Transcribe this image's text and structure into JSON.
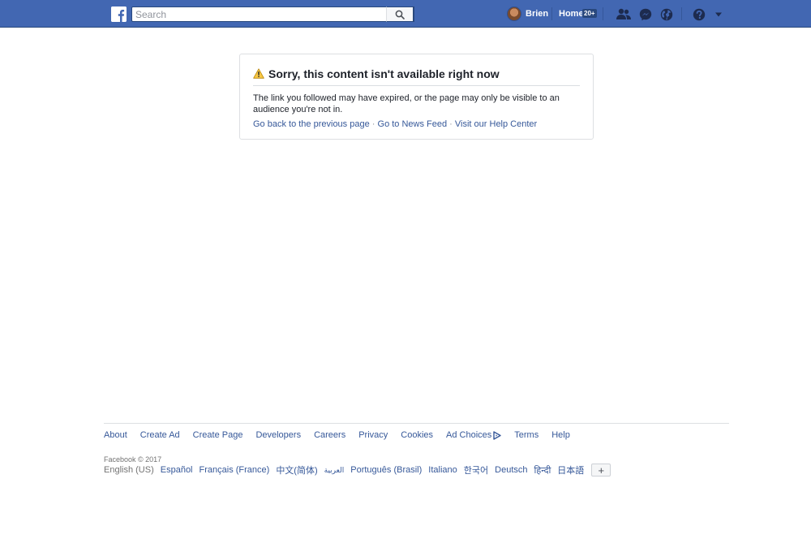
{
  "header": {
    "search_placeholder": "Search",
    "user_name": "Brien",
    "home_label": "Home",
    "home_badge": "20+"
  },
  "error": {
    "title": "Sorry, this content isn't available right now",
    "message": "The link you followed may have expired, or the page may only be visible to an audience you're not in.",
    "links": [
      "Go back to the previous page",
      "Go to News Feed",
      "Visit our Help Center"
    ],
    "separator": "·"
  },
  "footer": {
    "links": [
      "About",
      "Create Ad",
      "Create Page",
      "Developers",
      "Careers",
      "Privacy",
      "Cookies",
      "Ad Choices",
      "Terms",
      "Help"
    ],
    "copyright": "Facebook © 2017",
    "current_language": "English (US)",
    "languages": [
      "Español",
      "Français (France)",
      "中文(简体)",
      "العربية",
      "Português (Brasil)",
      "Italiano",
      "한국어",
      "Deutsch",
      "हिन्दी",
      "日本語"
    ],
    "add_language": "+"
  },
  "colors": {
    "brand": "#4267b2",
    "link": "#365899"
  }
}
